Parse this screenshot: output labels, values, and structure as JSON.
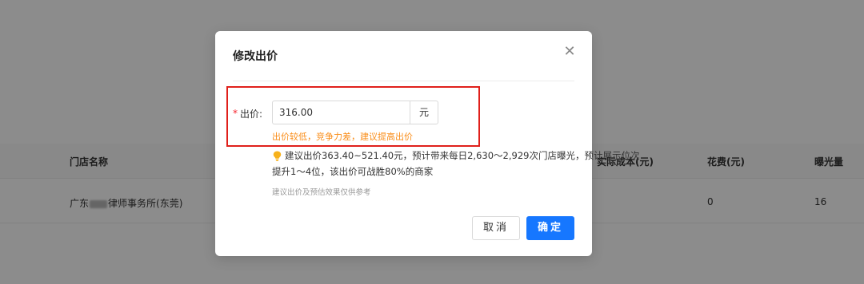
{
  "table": {
    "headers": {
      "store_name": "门店名称",
      "actual_cost": "实际成本(元)",
      "spend": "花费(元)",
      "impressions": "曝光量"
    },
    "rows": [
      {
        "store_name_prefix": "广东",
        "store_name_suffix": "律师事务所(东莞)",
        "spend": "0",
        "impressions": "16"
      }
    ]
  },
  "modal": {
    "title": "修改出价",
    "close_symbol": "✕",
    "bid_required_mark": "*",
    "bid_label": "出价:",
    "bid_value": "316.00",
    "bid_unit": "元",
    "warning": "出价较低，竞争力差，建议提高出价",
    "suggestion_icon": "lightbulb-icon",
    "suggestion_line1": "建议出价363.40~521.40元，预计带来每日2,630～2,929次门店曝光，预计展示位次",
    "suggestion_line2": "提升1～4位，该出价可战胜80%的商家",
    "note": "建议出价及预估效果仅供参考",
    "cancel_label": "取消",
    "confirm_label": "确定"
  },
  "colors": {
    "primary": "#1677ff",
    "warning": "#fa8c16",
    "required": "#f5222d",
    "highlight_border": "#e0201b",
    "bulb": "#f7b21b"
  }
}
